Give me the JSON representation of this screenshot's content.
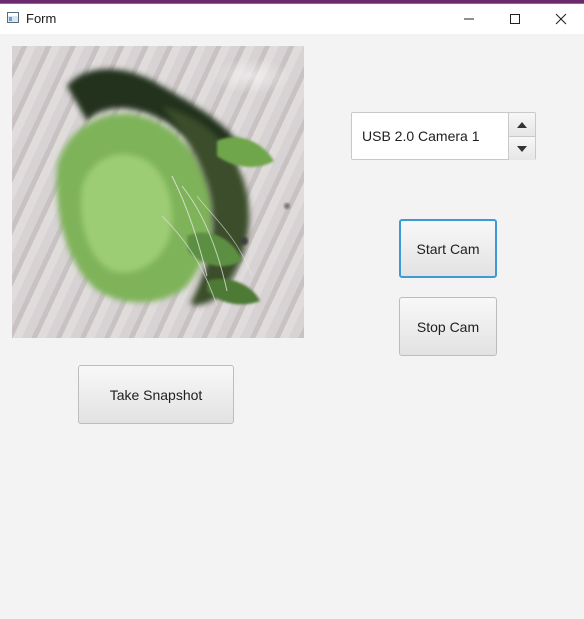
{
  "window": {
    "title": "Form",
    "controls": {
      "minimize_icon": "minimize-icon",
      "maximize_icon": "maximize-icon",
      "close_icon": "close-icon"
    }
  },
  "camera_view": {
    "icon": "camera-preview-image"
  },
  "camera_select": {
    "value": "USB 2.0 Camera 1",
    "up_icon": "triangle-up-icon",
    "down_icon": "triangle-down-icon"
  },
  "buttons": {
    "start": "Start Cam",
    "stop": "Stop Cam",
    "snapshot": "Take Snapshot"
  },
  "colors": {
    "focus_border": "#3c9bd6",
    "background": "#f3f3f3",
    "titlebar": "#ffffff"
  }
}
